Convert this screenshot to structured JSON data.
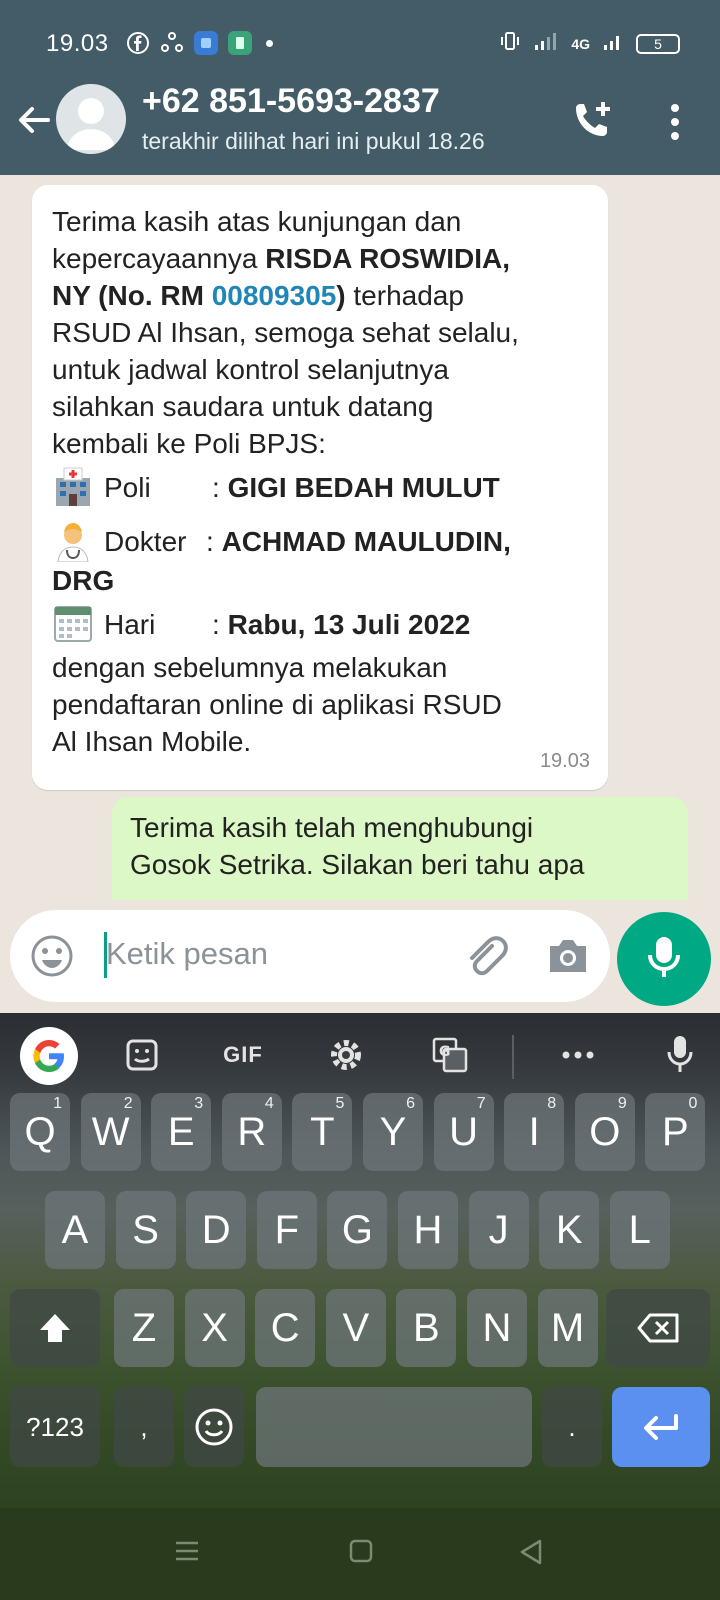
{
  "status_bar": {
    "time": "19.03",
    "network": "4G",
    "battery": "5"
  },
  "header": {
    "contact": "+62 851-5693-2837",
    "last_seen": "terakhir dilihat hari ini pukul 18.26"
  },
  "messages": {
    "incoming": {
      "intro_lines": [
        "Terima kasih atas kunjungan dan",
        "kepercayaannya"
      ],
      "patient_name": "RISDA ROSWIDIA,",
      "ny_prefix": "NY (No. RM ",
      "rm_number": "00809305",
      "ny_suffix": ")",
      "after_rm": " terhadap",
      "body_lines": [
        "RSUD Al Ihsan, semoga sehat selalu,",
        "untuk jadwal kontrol selanjutnya",
        "silahkan saudara untuk datang",
        "kembali ke Poli BPJS:"
      ],
      "poli_label": "Poli",
      "poli_value": "GIGI BEDAH MULUT",
      "doctor_label": "Dokter",
      "doctor_value": "ACHMAD MAULUDIN,",
      "doctor_value2": "DRG",
      "day_label": "Hari",
      "day_value": "Rabu, 13 Juli 2022",
      "closing_lines": [
        "dengan sebelumnya melakukan",
        "pendaftaran online di aplikasi RSUD",
        "Al Ihsan Mobile."
      ],
      "time": "19.03"
    },
    "outgoing": {
      "lines": [
        "Terima kasih telah menghubungi",
        "Gosok Setrika. Silakan beri tahu apa"
      ]
    }
  },
  "composer": {
    "placeholder": "Ketik pesan"
  },
  "keyboard": {
    "toolbar_gif": "GIF",
    "row1": [
      {
        "k": "Q",
        "n": "1"
      },
      {
        "k": "W",
        "n": "2"
      },
      {
        "k": "E",
        "n": "3"
      },
      {
        "k": "R",
        "n": "4"
      },
      {
        "k": "T",
        "n": "5"
      },
      {
        "k": "Y",
        "n": "6"
      },
      {
        "k": "U",
        "n": "7"
      },
      {
        "k": "I",
        "n": "8"
      },
      {
        "k": "O",
        "n": "9"
      },
      {
        "k": "P",
        "n": "0"
      }
    ],
    "row2": [
      "A",
      "S",
      "D",
      "F",
      "G",
      "H",
      "J",
      "K",
      "L"
    ],
    "row3": [
      "Z",
      "X",
      "C",
      "V",
      "B",
      "N",
      "M"
    ],
    "symbols_key": "?123",
    "comma_key": ",",
    "period_key": "."
  },
  "colors": {
    "header_bg": "#445c67",
    "accent_green": "#00a884",
    "incoming_bubble": "#ffffff",
    "outgoing_bubble": "#dcf8c6",
    "link_blue": "#1f86b6",
    "enter_key": "#5b8ff0"
  }
}
